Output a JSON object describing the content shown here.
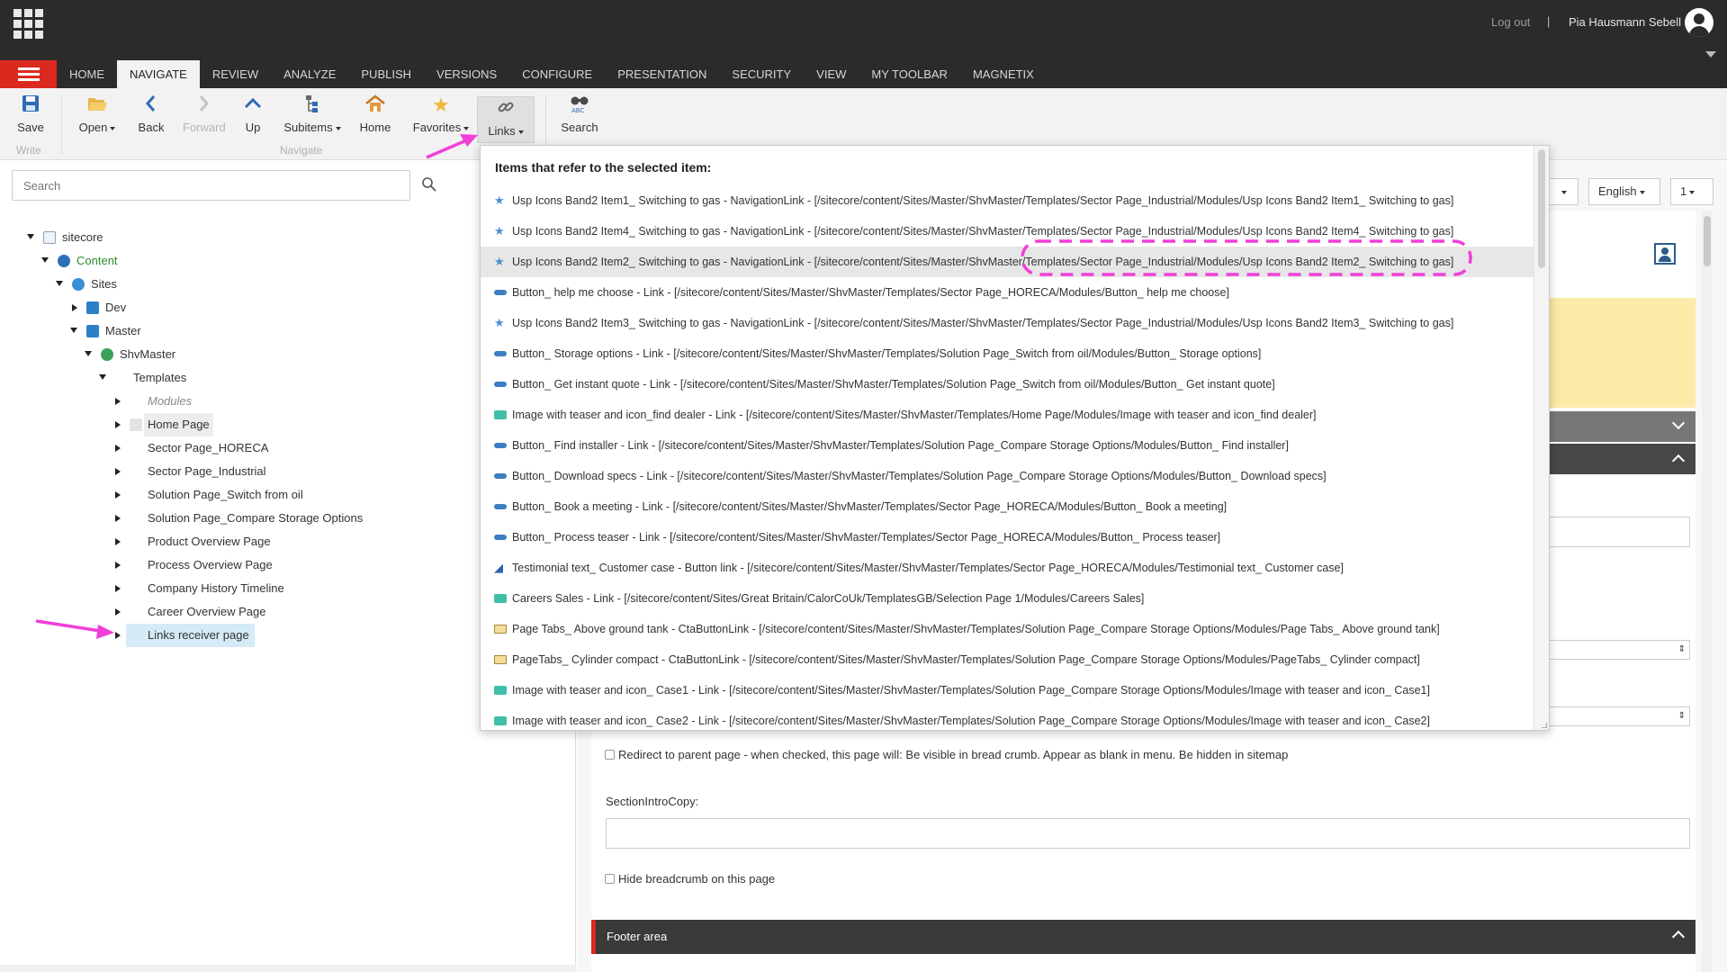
{
  "topbar": {
    "logout": "Log out",
    "separator": "|",
    "username": "Pia Hausmann Sebell"
  },
  "tabs": [
    "HOME",
    "NAVIGATE",
    "REVIEW",
    "ANALYZE",
    "PUBLISH",
    "VERSIONS",
    "CONFIGURE",
    "PRESENTATION",
    "SECURITY",
    "VIEW",
    "MY TOOLBAR",
    "MAGNETIX"
  ],
  "active_tab": "NAVIGATE",
  "ribbon": {
    "save": "Save",
    "write_group": "Write",
    "open": "Open",
    "back": "Back",
    "forward": "Forward",
    "up": "Up",
    "subitems": "Subitems",
    "home": "Home",
    "favorites": "Favorites",
    "links": "Links",
    "search": "Search",
    "navigate_group": "Navigate"
  },
  "search": {
    "placeholder": "Search"
  },
  "tree": {
    "sitecore": "sitecore",
    "content": "Content",
    "sites": "Sites",
    "dev": "Dev",
    "master": "Master",
    "shvmaster": "ShvMaster",
    "templates": "Templates",
    "modules": "Modules",
    "home_page": "Home Page",
    "sector_horeca": "Sector Page_HORECA",
    "sector_industrial": "Sector Page_Industrial",
    "solution_switch": "Solution Page_Switch from oil",
    "solution_compare": "Solution Page_Compare Storage Options",
    "product_overview": "Product Overview Page",
    "process_overview": "Process Overview Page",
    "company_history": "Company History Timeline",
    "career_overview": "Career Overview Page",
    "links_receiver": "Links receiver page"
  },
  "links_popup": {
    "heading": "Items that refer to the selected item:",
    "items": [
      {
        "icon": "star",
        "text": "Usp Icons Band2 Item1_ Switching to gas - NavigationLink - [/sitecore/content/Sites/Master/ShvMaster/Templates/Sector Page_Industrial/Modules/Usp Icons Band2 Item1_ Switching to gas]"
      },
      {
        "icon": "star",
        "text": "Usp Icons Band2 Item4_ Switching to gas - NavigationLink - [/sitecore/content/Sites/Master/ShvMaster/Templates/Sector Page_Industrial/Modules/Usp Icons Band2 Item4_ Switching to gas]"
      },
      {
        "icon": "star",
        "text": "Usp Icons Band2 Item2_ Switching to gas - NavigationLink - [/sitecore/content/Sites/Master/ShvMaster/Templates/Sector Page_Industrial/Modules/Usp Icons Band2 Item2_ Switching to gas]"
      },
      {
        "icon": "button",
        "text": "Button_ help me choose - Link - [/sitecore/content/Sites/Master/ShvMaster/Templates/Sector Page_HORECA/Modules/Button_ help me choose]"
      },
      {
        "icon": "star",
        "text": "Usp Icons Band2 Item3_ Switching to gas - NavigationLink - [/sitecore/content/Sites/Master/ShvMaster/Templates/Sector Page_Industrial/Modules/Usp Icons Band2 Item3_ Switching to gas]"
      },
      {
        "icon": "button",
        "text": "Button_ Storage options - Link - [/sitecore/content/Sites/Master/ShvMaster/Templates/Solution Page_Switch from oil/Modules/Button_ Storage options]"
      },
      {
        "icon": "button",
        "text": "Button_ Get instant quote - Link - [/sitecore/content/Sites/Master/ShvMaster/Templates/Solution Page_Switch from oil/Modules/Button_ Get instant quote]"
      },
      {
        "icon": "image",
        "text": "Image with teaser and icon_find dealer - Link - [/sitecore/content/Sites/Master/ShvMaster/Templates/Home Page/Modules/Image with teaser and icon_find dealer]"
      },
      {
        "icon": "button",
        "text": "Button_ Find installer - Link - [/sitecore/content/Sites/Master/ShvMaster/Templates/Solution Page_Compare Storage Options/Modules/Button_ Find installer]"
      },
      {
        "icon": "button",
        "text": "Button_ Download specs - Link - [/sitecore/content/Sites/Master/ShvMaster/Templates/Solution Page_Compare Storage Options/Modules/Button_ Download specs]"
      },
      {
        "icon": "button",
        "text": "Button_ Book a meeting - Link - [/sitecore/content/Sites/Master/ShvMaster/Templates/Sector Page_HORECA/Modules/Button_ Book a meeting]"
      },
      {
        "icon": "button",
        "text": "Button_ Process teaser - Link - [/sitecore/content/Sites/Master/ShvMaster/Templates/Sector Page_HORECA/Modules/Button_ Process teaser]"
      },
      {
        "icon": "testimonial",
        "text": "Testimonial text_ Customer case - Button link - [/sitecore/content/Sites/Master/ShvMaster/Templates/Sector Page_HORECA/Modules/Testimonial text_ Customer case]"
      },
      {
        "icon": "image",
        "text": "Careers Sales - Link - [/sitecore/content/Sites/Great Britain/CalorCoUk/TemplatesGB/Selection Page 1/Modules/Careers Sales]"
      },
      {
        "icon": "folder",
        "text": "Page Tabs_ Above ground tank - CtaButtonLink - [/sitecore/content/Sites/Master/ShvMaster/Templates/Solution Page_Compare Storage Options/Modules/Page Tabs_ Above ground tank]"
      },
      {
        "icon": "folder",
        "text": "PageTabs_ Cylinder compact - CtaButtonLink - [/sitecore/content/Sites/Master/ShvMaster/Templates/Solution Page_Compare Storage Options/Modules/PageTabs_ Cylinder compact]"
      },
      {
        "icon": "image",
        "text": "Image with teaser and icon_ Case1 - Link - [/sitecore/content/Sites/Master/ShvMaster/Templates/Solution Page_Compare Storage Options/Modules/Image with teaser and icon_ Case1]"
      },
      {
        "icon": "image",
        "text": "Image with teaser and icon_ Case2 - Link - [/sitecore/content/Sites/Master/ShvMaster/Templates/Solution Page_Compare Storage Options/Modules/Image with teaser and icon_ Case2]"
      }
    ]
  },
  "right": {
    "language": "English",
    "version": "1",
    "redirect_label": "Redirect to parent page - when checked, this page will: Be visible in bread crumb. Appear as blank in menu. Be hidden in sitemap",
    "section_intro_label": "SectionIntroCopy:",
    "hide_breadcrumb_label": "Hide breadcrumb on this page",
    "footer_section": "Footer area"
  },
  "colors": {
    "accent_red": "#dc291e",
    "annotation_magenta": "#f23fd8",
    "topbar": "#2b2b2b"
  }
}
